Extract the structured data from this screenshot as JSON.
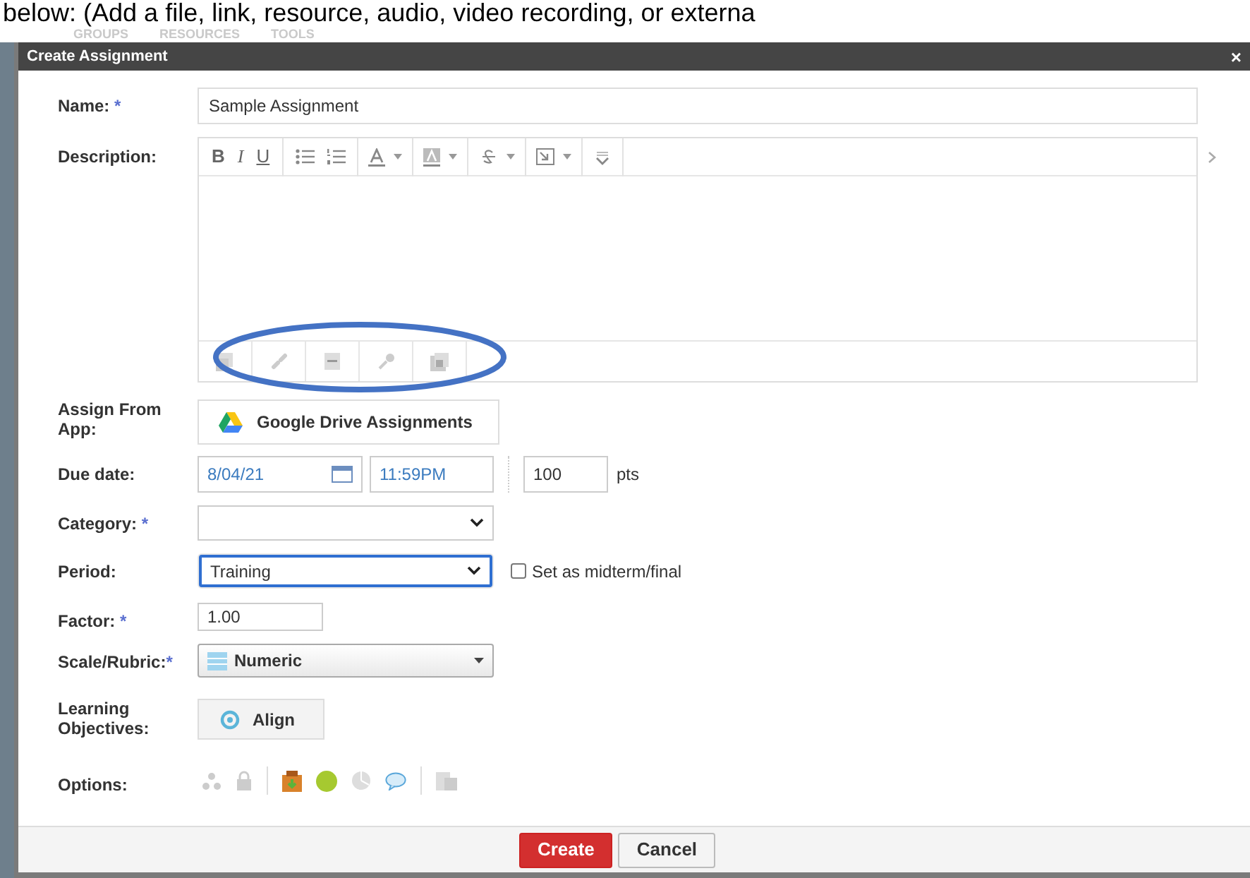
{
  "caption": "below: (Add a file, link, resource, audio, video recording, or externa",
  "nav": [
    "GROUPS",
    "RESOURCES",
    "TOOLS"
  ],
  "dialog": {
    "title": "Create Assignment",
    "close": "×"
  },
  "fields": [
    {
      "kind": "text",
      "label": "Name:",
      "required": "*",
      "value": "Sample Assignment"
    },
    {
      "kind": "editor",
      "label": "Description:",
      "format_buttons": [
        {
          "label": "B",
          "kind": "bold"
        },
        {
          "label": "I",
          "kind": "italic"
        },
        {
          "label": "U",
          "kind": "underline"
        }
      ]
    },
    {
      "kind": "app",
      "label": "Assign From App:",
      "button": "Google Drive Assignments"
    },
    {
      "kind": "due",
      "label": "Due date:",
      "date": "8/04/21",
      "time": "11:59PM",
      "points": "100",
      "unit": "pts"
    },
    {
      "kind": "select",
      "label": "Category:",
      "required": "*",
      "focused": false
    },
    {
      "kind": "select",
      "label": "Period:",
      "value": "Training",
      "focused": true,
      "checkbox": {
        "label": "Set as midterm/final",
        "checked": false
      }
    },
    {
      "kind": "text_short",
      "label": "Factor:",
      "required": "*",
      "value": "1.00"
    },
    {
      "kind": "rubric",
      "label": "Scale/Rubric:",
      "required": "*",
      "value": "Numeric"
    },
    {
      "kind": "align",
      "label": "Learning Objectives:",
      "button": "Align"
    },
    {
      "kind": "options",
      "label": "Options:"
    }
  ],
  "footer": [
    {
      "label": "Create",
      "kind": "primary"
    },
    {
      "label": "Cancel",
      "kind": "secondary"
    }
  ]
}
